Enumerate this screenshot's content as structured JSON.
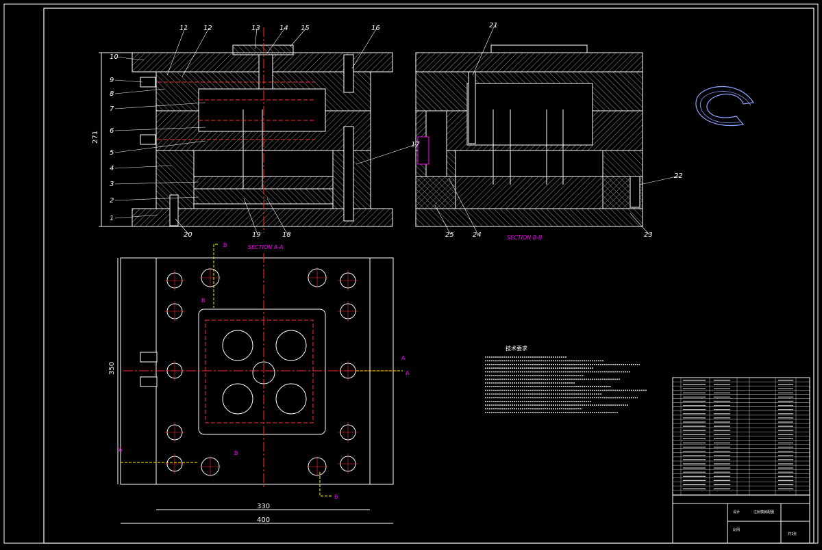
{
  "colors": {
    "background": "#000000",
    "line": "#ffffff",
    "hatch": "#cfcfcf",
    "centerline": "#ff3030",
    "section": "#ff00ff",
    "cooling": "#ff3030",
    "projection": "#ffff00",
    "leader": "#ffffff",
    "dimension": "#ffffff",
    "label": "#ffffff",
    "part": "#8ea6ff"
  },
  "section_a_label": "SECTION A-A",
  "section_b_label": "SECTION B-B",
  "part_numbers": [
    "1",
    "2",
    "3",
    "4",
    "5",
    "6",
    "7",
    "8",
    "9",
    "10",
    "11",
    "12",
    "13",
    "14",
    "15",
    "16",
    "17",
    "18",
    "19",
    "20",
    "21",
    "22",
    "23",
    "24",
    "25"
  ],
  "dimensions": {
    "height": "271",
    "width_top": "350",
    "width_inner": "330",
    "width_outer": "400"
  },
  "plan_view_markers": {
    "a_left": "A",
    "a_right": "A",
    "a_lower": "A",
    "b_top": "B",
    "b_bottom": "B",
    "b_mid1": "B",
    "b_mid2": "B"
  },
  "technical_requirements_title": "技术要求",
  "title_block": {
    "designer_label": "设计",
    "drawing_name": "注射模装配图",
    "scale_label": "比例",
    "sheet_label": "共1张"
  }
}
